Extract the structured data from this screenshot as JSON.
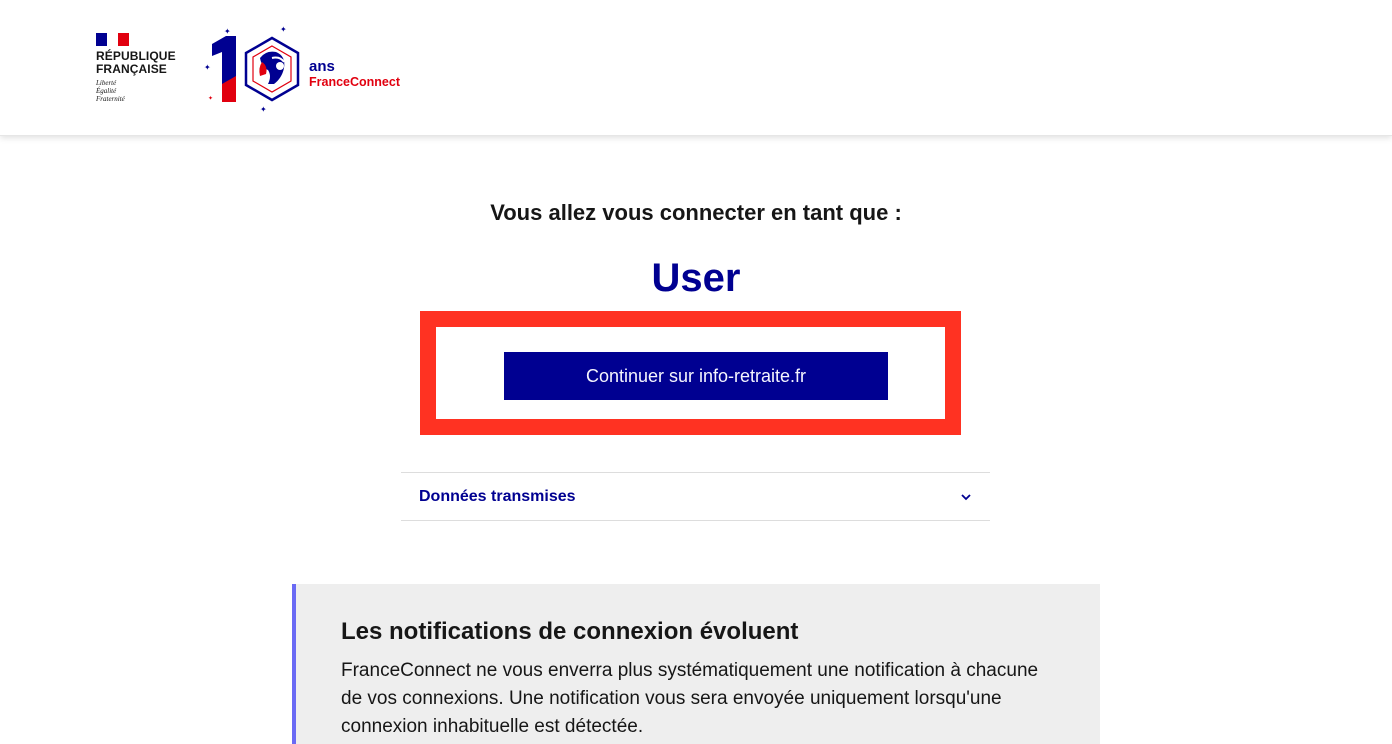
{
  "header": {
    "gov_title": "RÉPUBLIQUE\nFRANÇAISE",
    "gov_motto": "Liberté\nÉgalité\nFraternité",
    "logo_number": "10",
    "logo_ans": "ans",
    "logo_name": "FranceConnect",
    "icons": [
      "marianne-flag-icon",
      "france-connect-10-ans-logo"
    ],
    "colors": {
      "blue_france": "#000091",
      "red_marianne": "#e1000f"
    }
  },
  "main": {
    "intro": "Vous allez vous connecter en tant que :",
    "username": "User",
    "continue_label": "Continuer sur info-retraite.fr",
    "accordion_label": "Données transmises",
    "accordion_icon": "chevron-down-icon",
    "highlight_color": "#ff3222"
  },
  "notice": {
    "title": "Les notifications de connexion évoluent",
    "text": "FranceConnect ne vous enverra plus systématiquement une notification à chacune de vos connexions. Une notification vous sera envoyée uniquement lorsqu'une connexion inhabituelle est détectée."
  }
}
